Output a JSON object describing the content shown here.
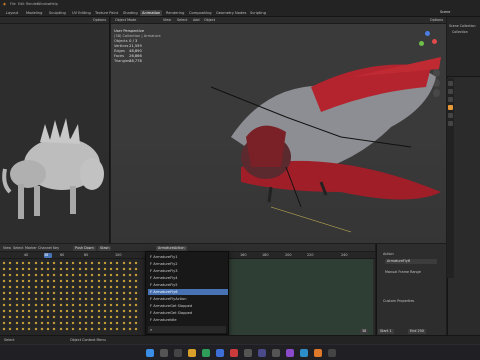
{
  "app": {
    "menus": [
      "File",
      "Edit",
      "Render",
      "Window",
      "Help"
    ],
    "scene_label": "Scene"
  },
  "workspace_tabs": [
    "Layout",
    "Modeling",
    "Sculpting",
    "UV Editing",
    "Texture Paint",
    "Shading",
    "Animation",
    "Rendering",
    "Compositing",
    "Geometry Nodes",
    "Scripting"
  ],
  "active_workspace": "Animation",
  "viewport_header": {
    "mode": "Object Mode",
    "menus": [
      "View",
      "Select",
      "Add",
      "Object"
    ],
    "options": "Options"
  },
  "left_viewport": {
    "options": "Options"
  },
  "viewport_overlay": {
    "view_name": "User Perspective",
    "collection": "(38) Collection | Armature",
    "stats": [
      {
        "label": "Objects",
        "value": "0 / 3"
      },
      {
        "label": "Vertices",
        "value": "21,559"
      },
      {
        "label": "Edges",
        "value": "48,890"
      },
      {
        "label": "Faces",
        "value": "26,866"
      },
      {
        "label": "Triangles",
        "value": "38,778"
      }
    ]
  },
  "outliner": {
    "title": "Scene Collection",
    "items": [
      "Collection"
    ]
  },
  "dopesheet": {
    "menus": [
      "View",
      "Select",
      "Marker",
      "Channel",
      "Key"
    ],
    "push_down": "Push Down",
    "stash": "Stash",
    "action_name": "ArmatureAction",
    "nearest_frame": "Nearest Frame",
    "ruler": [
      "40",
      "60",
      "80",
      "100",
      "120",
      "140",
      "160",
      "180",
      "200",
      "220",
      "240"
    ]
  },
  "action_dropdown": {
    "items": [
      "F ArmatureFly1",
      "F ArmatureFly2",
      "F ArmatureFly3",
      "F ArmatureFly4",
      "F ArmatureFly5",
      "F ArmatureFly6",
      "F ArmatureFlyAction",
      "F ArmatureGet Slapped",
      "F ArmatureGet Slapped",
      "F ArmatureIdle"
    ],
    "selected_index": 5,
    "search_placeholder": ""
  },
  "ds_sidebar": {
    "section_action": "Action",
    "action_value": "ArmatureFly6",
    "manual_frame_range": "Manual Frame Range",
    "custom_properties": "Custom Properties"
  },
  "timeline_footer": {
    "current_frame": "38",
    "start_label": "Start",
    "start_value": "1",
    "end_label": "End",
    "end_value": "250"
  },
  "statusbar": {
    "left": "Select",
    "right": "Object Context Menu"
  }
}
